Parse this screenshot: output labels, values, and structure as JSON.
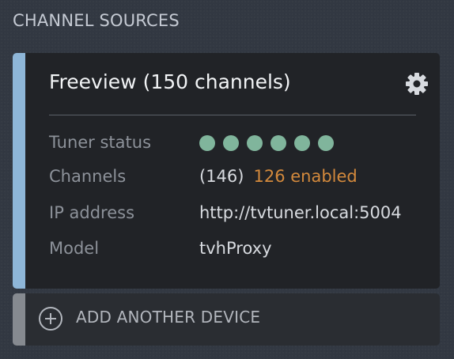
{
  "section": {
    "title": "CHANNEL SOURCES"
  },
  "device": {
    "title": "Freeview (150 channels)",
    "settings_icon": "gear-icon",
    "accent_color": "#8eb6d8",
    "rows": {
      "tuner_status": {
        "label": "Tuner status",
        "tuner_count": 6,
        "status_color": "#80b59c"
      },
      "channels": {
        "label": "Channels",
        "count": "(146)",
        "enabled": "126 enabled",
        "enabled_color": "#d3893c"
      },
      "ip_address": {
        "label": "IP address",
        "value": "http://tvtuner.local:5004"
      },
      "model": {
        "label": "Model",
        "value": "tvhProxy"
      }
    }
  },
  "add_device": {
    "label": "ADD ANOTHER DEVICE",
    "icon": "plus-circle-icon"
  }
}
